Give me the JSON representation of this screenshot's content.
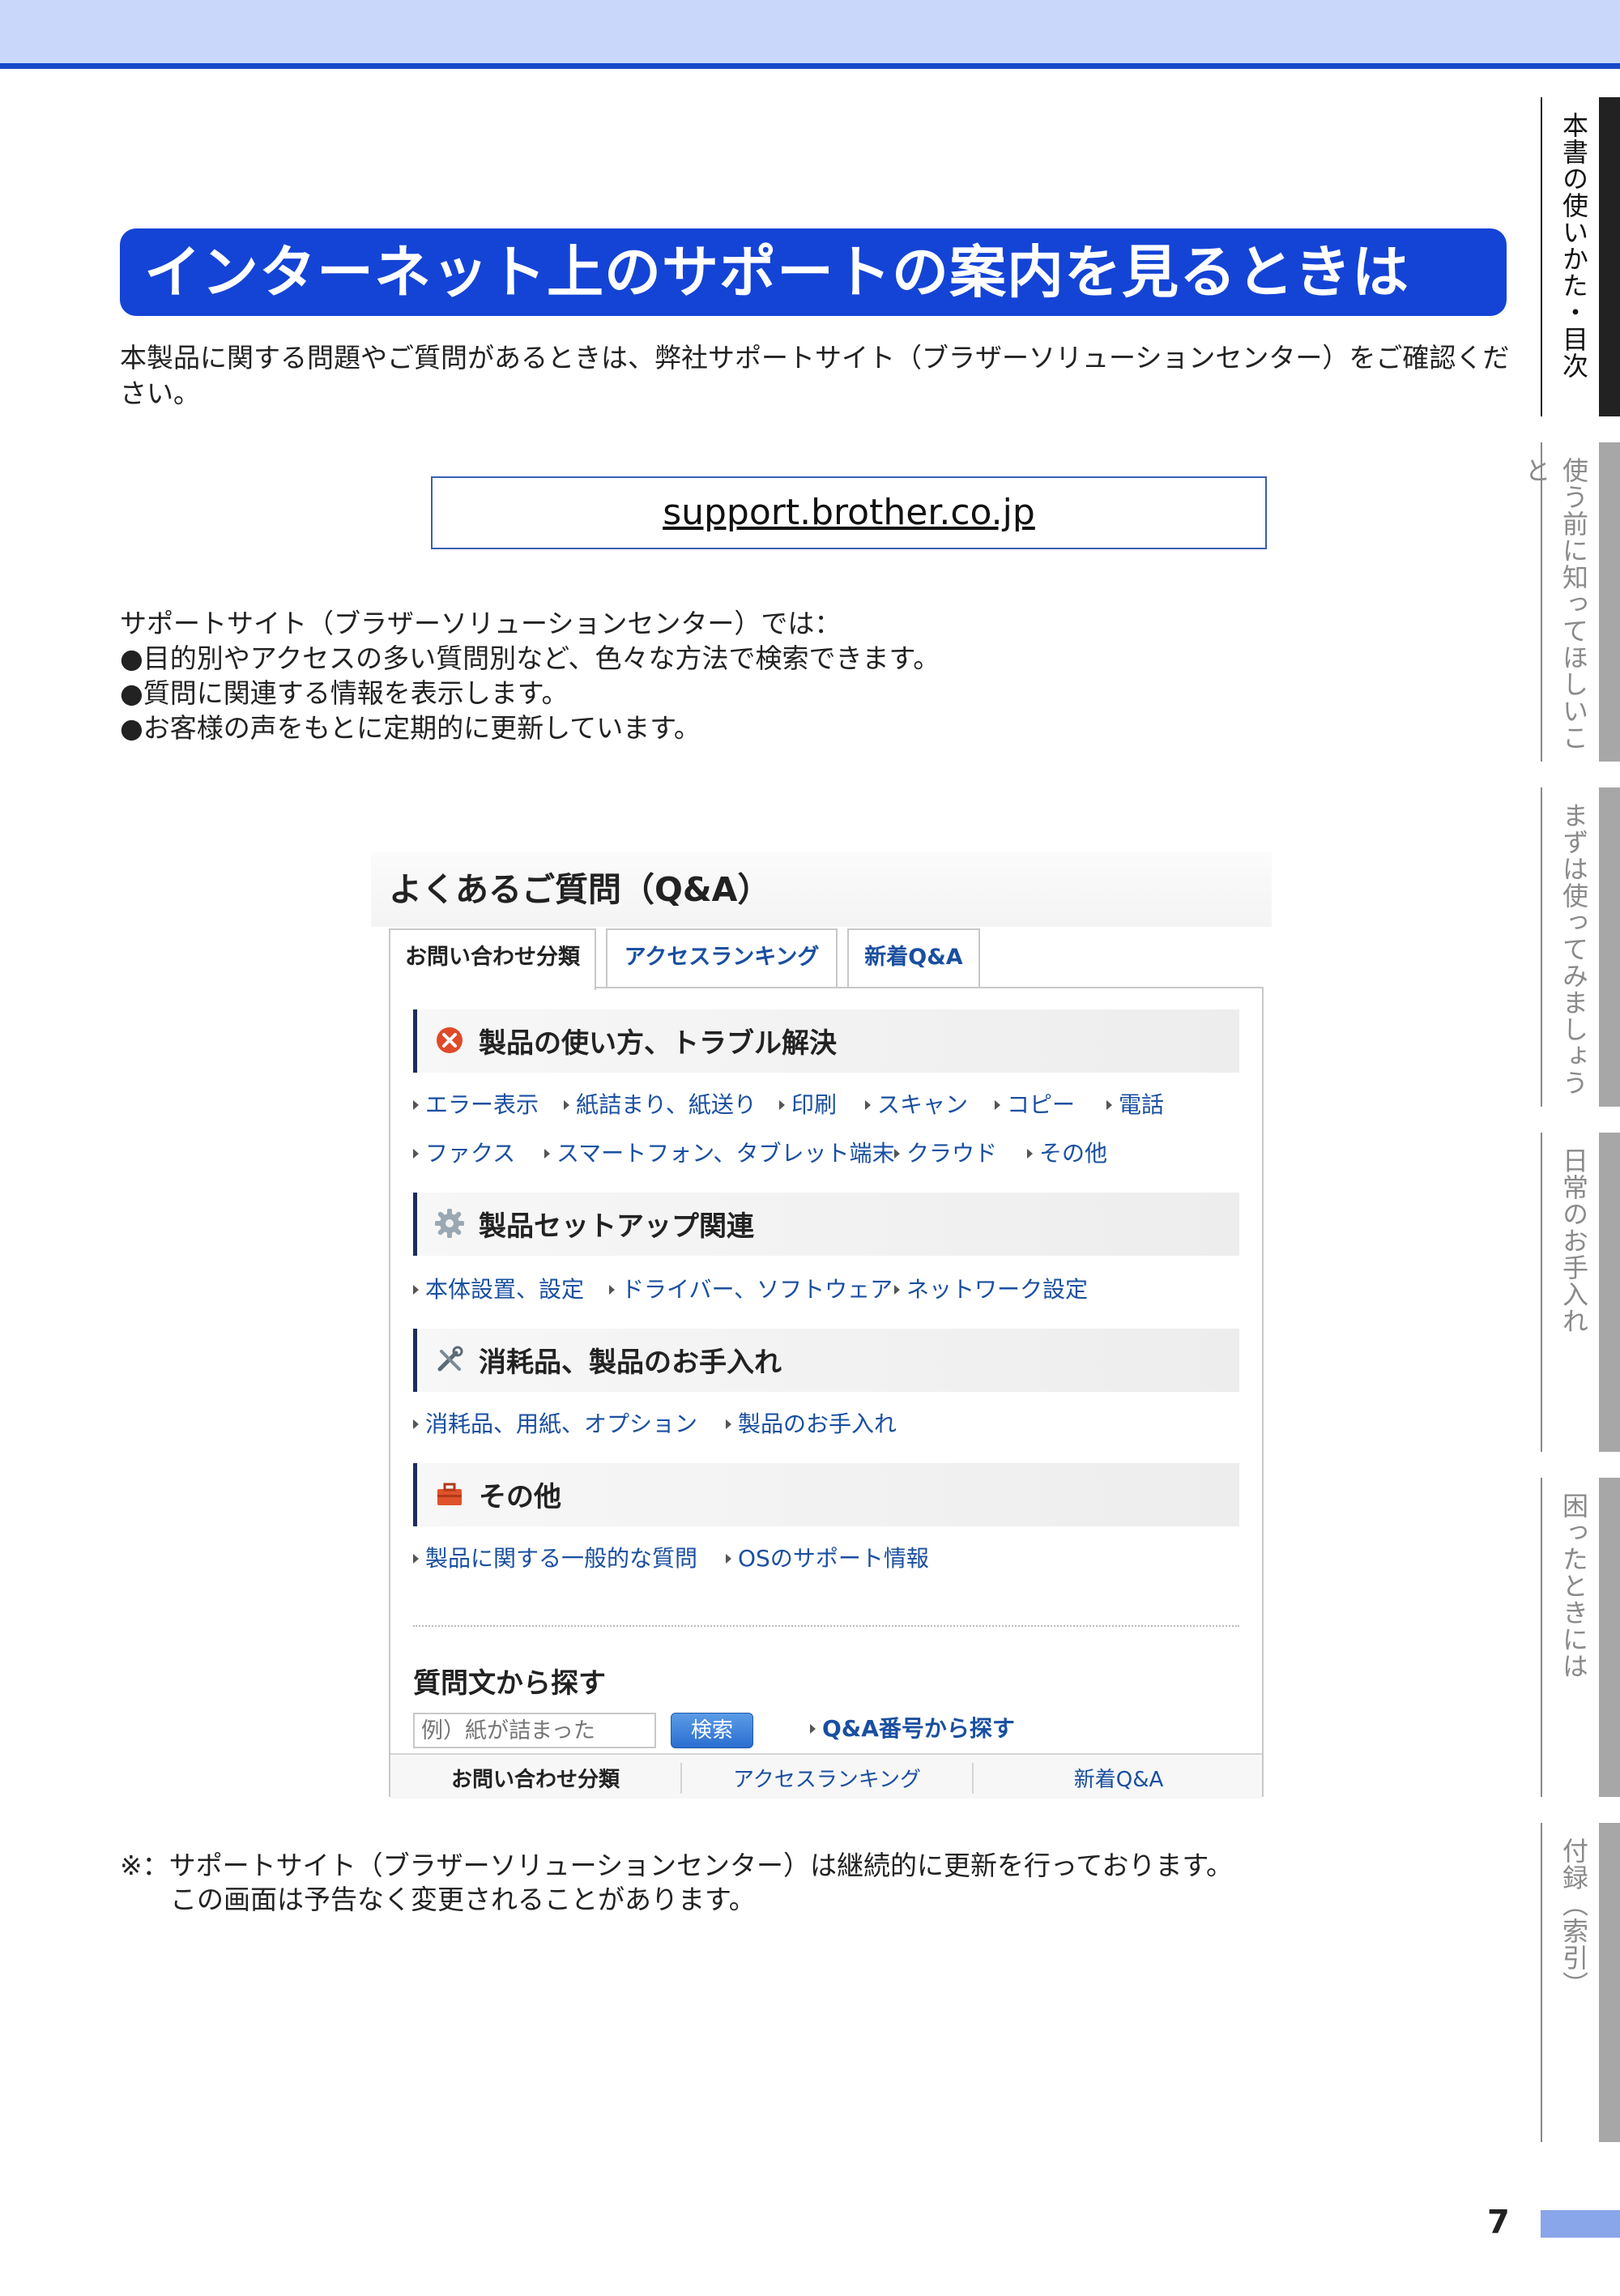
{
  "title": "インターネット上のサポートの案内を見るときは",
  "intro": "本製品に関する問題やご質問があるときは、弊社サポートサイト（ブラザーソリューションセンター）をご確認ください。",
  "url": "support.brother.co.jp",
  "features": {
    "lead": "サポートサイト（ブラザーソリューションセンター）では：",
    "items": [
      "●目的別やアクセスの多い質問別など、色々な方法で検索できます。",
      "●質問に関連する情報を表示します。",
      "●お客様の声をもとに定期的に更新しています。"
    ]
  },
  "screenshot": {
    "title": "よくあるご質問（Q&A）",
    "tabs": [
      "お問い合わせ分類",
      "アクセスランキング",
      "新着Q&A"
    ],
    "categories": [
      {
        "title": "製品の使い方、トラブル解決",
        "icon": "error-icon",
        "links": [
          [
            "エラー表示",
            "紙詰まり、紙送り",
            "印刷",
            "スキャン",
            "コピー",
            "電話"
          ],
          [
            "ファクス",
            "スマートフォン、タブレット端末",
            "クラウド",
            "その他"
          ]
        ]
      },
      {
        "title": "製品セットアップ関連",
        "icon": "gear-icon",
        "links": [
          [
            "本体設置、設定",
            "ドライバー、ソフトウェア",
            "ネットワーク設定"
          ]
        ]
      },
      {
        "title": "消耗品、製品のお手入れ",
        "icon": "tools-icon",
        "links": [
          [
            "消耗品、用紙、オプション",
            "製品のお手入れ"
          ]
        ]
      },
      {
        "title": "その他",
        "icon": "toolbox-icon",
        "links": [
          [
            "製品に関する一般的な質問",
            "OSのサポート情報"
          ]
        ]
      }
    ],
    "search": {
      "heading": "質問文から探す",
      "placeholder": "例）紙が詰まった",
      "button": "検索",
      "qa_number_link": "Q&A番号から探す"
    },
    "footer_tabs": [
      "お問い合わせ分類",
      "アクセスランキング",
      "新着Q&A"
    ]
  },
  "note": [
    "※：サポートサイト（ブラザーソリューションセンター）は継続的に更新を行っております。",
    "この画面は予告なく変更されることがあります。"
  ],
  "side_tabs": [
    "本書の使いかた・目次",
    "使う前に知ってほしいこと",
    "まずは使ってみましょう",
    "日常のお手入れ",
    "困ったときには",
    "付録（索引）"
  ],
  "page_number": "7",
  "colors": {
    "title_bg": "#1444d6",
    "header_band": "#c9d8fa",
    "header_line": "#1549c9",
    "link": "#1a4fa0",
    "page_bar": "#8aa6ea"
  }
}
